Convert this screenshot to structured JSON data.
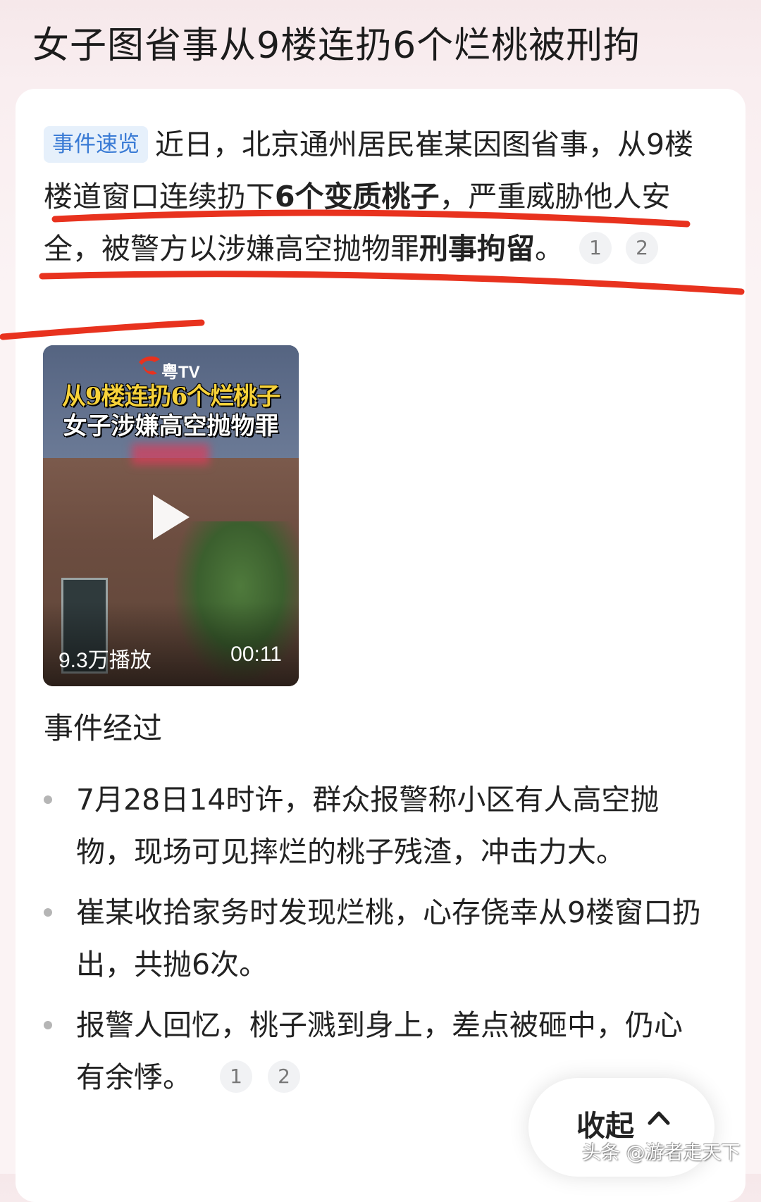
{
  "page": {
    "title": "女子图省事从9楼连扔6个烂桃被刑拘"
  },
  "summary": {
    "tag": "事件速览",
    "text_1": "近日，北京通州居民崔某因图省事，从9楼楼道窗口连续扔下",
    "bold_1": "6个变质桃子",
    "text_2": "，严重威胁他人安全，被警方以涉嫌高空抛物罪",
    "bold_2": "刑事拘留",
    "text_3": "。",
    "citations": [
      "1",
      "2"
    ]
  },
  "video": {
    "logo": "粤TV",
    "headline_1": "从9楼连扔6个烂桃子",
    "headline_2": "女子涉嫌高空抛物罪",
    "views": "9.3万播放",
    "duration": "00:11"
  },
  "section": {
    "title": "事件经过"
  },
  "bullets": [
    {
      "text": "7月28日14时许，群众报警称小区有人高空抛物，现场可见摔烂的桃子残渣，冲击力大。"
    },
    {
      "text": "崔某收拾家务时发现烂桃，心存侥幸从9楼窗口扔出，共抛6次。"
    },
    {
      "text": "报警人回忆，桃子溅到身上，差点被砸中，仍心有余悸。",
      "citations": [
        "1",
        "2"
      ]
    }
  ],
  "collapse": {
    "label": "收起"
  },
  "watermark": "头条 @游者走天下",
  "colors": {
    "tag_bg": "#e6f0fb",
    "tag_text": "#3a7bd5",
    "annotation_red": "#e8321e",
    "headline_yellow": "#f7d23a"
  }
}
